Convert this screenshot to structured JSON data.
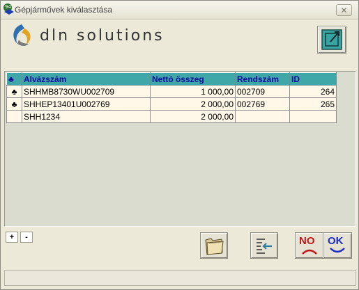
{
  "window": {
    "title": "Gépjárművek kiválasztása"
  },
  "logo": {
    "text": "DLN SOLUTIONS"
  },
  "grid": {
    "indicator_header": "♣",
    "columns": [
      "Alvázszám",
      "Nettó összeg",
      "Rendszám",
      "ID"
    ],
    "rows": [
      {
        "indicator": "♣",
        "alvazszam": "SHHMB8730WU002709",
        "netto": "1 000,00",
        "rendszam": "002709",
        "id": "264"
      },
      {
        "indicator": "♣",
        "alvazszam": "SHHEP13401U002769",
        "netto": "2 000,00",
        "rendszam": "002769",
        "id": "265"
      },
      {
        "indicator": "",
        "alvazszam": "SHH1234",
        "netto": "2 000,00",
        "rendszam": "",
        "id": ""
      }
    ]
  },
  "buttons": {
    "add_label": "+",
    "remove_label": "-",
    "no_label": "NO",
    "ok_label": "OK"
  },
  "colors": {
    "header": "#3fa7a7",
    "id_cell": "#f7b27a",
    "error_cell": "#ff4040",
    "row": "#fff8e8"
  }
}
